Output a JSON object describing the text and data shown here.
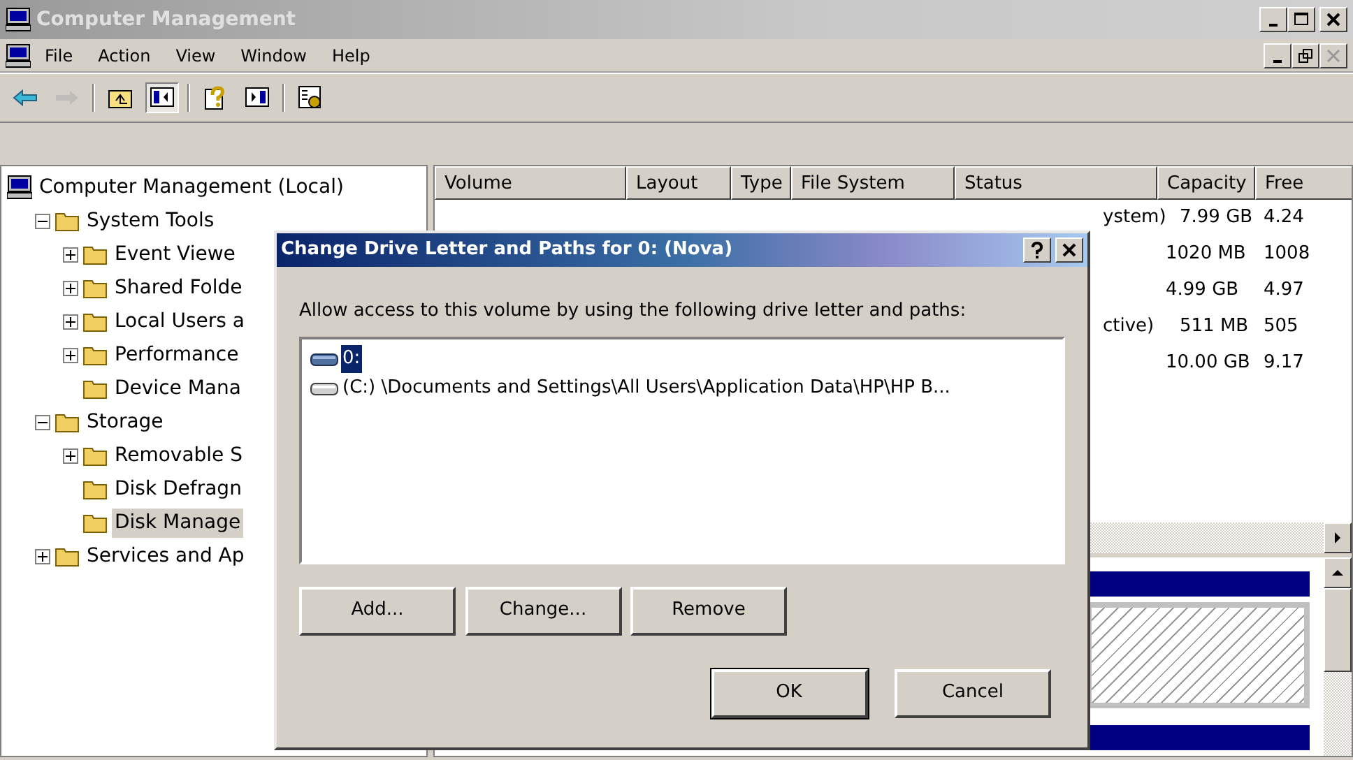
{
  "window": {
    "title": "Computer Management"
  },
  "menu": [
    "File",
    "Action",
    "View",
    "Window",
    "Help"
  ],
  "toolbar": [
    {
      "kind": "back",
      "disabled": false,
      "pressed": false
    },
    {
      "kind": "forward",
      "disabled": true,
      "pressed": false
    },
    {
      "kind": "sep"
    },
    {
      "kind": "up",
      "disabled": false,
      "pressed": false
    },
    {
      "kind": "tree",
      "disabled": false,
      "pressed": true
    },
    {
      "kind": "sep"
    },
    {
      "kind": "help",
      "disabled": false,
      "pressed": false
    },
    {
      "kind": "pane",
      "disabled": false,
      "pressed": false
    },
    {
      "kind": "sep"
    },
    {
      "kind": "props",
      "disabled": false,
      "pressed": false
    }
  ],
  "tree": [
    {
      "label": "Computer Management (Local)",
      "selected": false,
      "children": [
        {
          "label": "System Tools",
          "kind": "expanded",
          "selected": false,
          "children": [
            {
              "label": "Event Viewe",
              "kind": "collapsed",
              "selected": false
            },
            {
              "label": "Shared Folde",
              "kind": "collapsed",
              "selected": false
            },
            {
              "label": "Local Users a",
              "kind": "collapsed",
              "selected": false
            },
            {
              "label": "Performance",
              "kind": "collapsed",
              "selected": false
            },
            {
              "label": "Device Mana",
              "kind": "leaf",
              "selected": false
            }
          ]
        },
        {
          "label": "Storage",
          "kind": "expanded",
          "selected": false,
          "children": [
            {
              "label": "Removable S",
              "kind": "collapsed",
              "selected": false
            },
            {
              "label": "Disk Defragn",
              "kind": "leaf",
              "selected": false
            },
            {
              "label": "Disk Manage",
              "kind": "leaf",
              "selected": true
            }
          ]
        },
        {
          "label": "Services and Ap",
          "kind": "collapsed",
          "selected": false
        }
      ]
    }
  ],
  "table": {
    "columns": [
      "Volume",
      "Layout",
      "Type",
      "File System",
      "Status",
      "Capacity",
      "Free"
    ],
    "rows": [
      {
        "status": "ystem)",
        "capacity": "7.99 GB",
        "free": "4.24"
      },
      {
        "status": "",
        "capacity": "1020 MB",
        "free": "1008"
      },
      {
        "status": "",
        "capacity": "4.99 GB",
        "free": "4.97"
      },
      {
        "status": "ctive)",
        "capacity": "511 MB",
        "free": "505"
      },
      {
        "status": "",
        "capacity": "10.00 GB",
        "free": "9.17"
      }
    ]
  },
  "dialog": {
    "title": "Change Drive Letter and Paths for 0: (Nova)",
    "prompt": "Allow access to this volume by using the following drive letter and paths:",
    "items": [
      {
        "label": "0:",
        "selected": true
      },
      {
        "label": "(C:) \\Documents and Settings\\All Users\\Application Data\\HP\\HP B...",
        "selected": false
      }
    ],
    "buttons": [
      "Add...",
      "Change...",
      "Remove"
    ],
    "footer_buttons": [
      {
        "label": "OK",
        "default": true
      },
      {
        "label": "Cancel",
        "default": false
      }
    ]
  }
}
